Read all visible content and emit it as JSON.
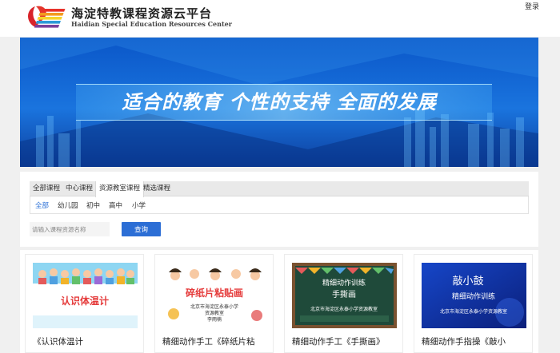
{
  "header": {
    "title_cn": "海淀特教课程资源云平台",
    "title_en": "Haidian Special Education Resources Center",
    "login": "登录"
  },
  "banner": {
    "slogan": "适合的教育  个性的支持  全面的发展"
  },
  "filters": {
    "tabs": [
      "全部课程",
      "中心课程",
      "资源教室课程",
      "精选课程"
    ],
    "active_tab": "资源教室课程",
    "levels": [
      "全部",
      "幼儿园",
      "初中",
      "高中",
      "小学"
    ],
    "active_level": "全部",
    "search_placeholder": "请输入课程资源名称",
    "query_label": "查询"
  },
  "courses": [
    {
      "title": "《认识体温计",
      "thumb_title": "认识体温计"
    },
    {
      "title": "精细动作手工《碎纸片粘",
      "thumb_title": "碎纸片粘贴画",
      "thumb_lines": [
        "北京市海淀区永泰小学",
        "资源教室",
        "李雨楠"
      ]
    },
    {
      "title": "精细动作手工《手撕画》",
      "thumb_title": "精细动作训练",
      "thumb_subtitle": "手撕画",
      "thumb_footer": "北京市海淀区永泰小学资源教室"
    },
    {
      "title": "精细动作手指操《敲小",
      "thumb_title": "敲小鼓",
      "thumb_subtitle": "精细动作训练",
      "thumb_footer": "北京市海淀区永泰小学资源教室"
    }
  ]
}
